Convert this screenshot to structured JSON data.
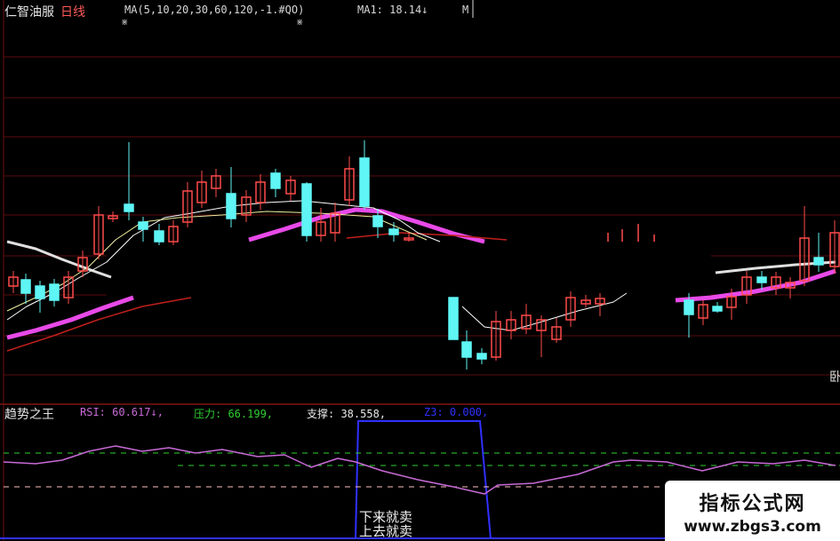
{
  "header": {
    "stock_name": "仁智油服",
    "period": "日线",
    "ma_params": "MA(5,10,20,30,60,120,-1.#QO)",
    "ma1": "MA1: 18.14↓",
    "ma_more": "M"
  },
  "indicator": {
    "name": "趋势之王",
    "rsi": "RSI: 60.617↓,",
    "pressure": "压力: 66.199,",
    "support": "支撑: 38.558,",
    "z3": "Z3: 0.000,"
  },
  "annotations": {
    "down_sell": "下来就卖",
    "up_sell": "上去就卖",
    "edge_char": "卧"
  },
  "watermark": {
    "title": "指标公式网",
    "url": "www.zbgs3.com"
  },
  "colors": {
    "background": "#000000",
    "up_candle": "#ff4b4b",
    "down_candle": "#5ff5f5",
    "ma_white": "#ffffff",
    "ma_thick": "#e84ae8",
    "ma_red": "#c0201c",
    "rsi_line": "#c86ad6",
    "pressure": "#30d030",
    "support": "#ffc0c0",
    "z3": "#3030ff"
  }
}
